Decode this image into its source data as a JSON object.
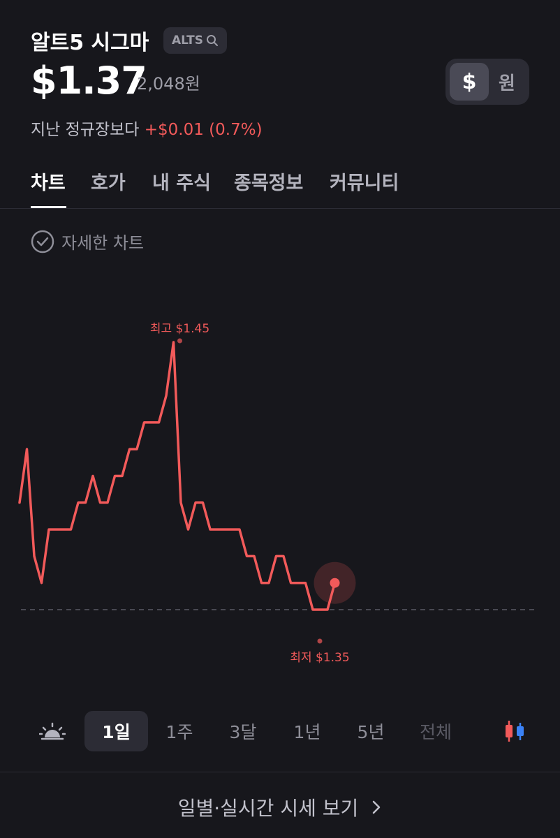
{
  "header": {
    "name": "알트5 시그마",
    "ticker": "ALTS",
    "price": "$1.37",
    "price_krw": "2,048원",
    "change_label": "지난 정규장보다",
    "change_value": "+$0.01 (0.7%)",
    "currency_usd": "$",
    "currency_krw": "원",
    "selected_currency": "$"
  },
  "tabs": [
    "차트",
    "호가",
    "내 주식",
    "종목정보",
    "커뮤니티"
  ],
  "active_tab": "차트",
  "detail_chart_label": "자세한 차트",
  "chart_data": {
    "type": "line",
    "color": "#f25a5a",
    "values": [
      1.39,
      1.41,
      1.37,
      1.36,
      1.38,
      1.38,
      1.38,
      1.38,
      1.39,
      1.39,
      1.4,
      1.39,
      1.39,
      1.4,
      1.4,
      1.41,
      1.41,
      1.42,
      1.42,
      1.42,
      1.43,
      1.45,
      1.39,
      1.38,
      1.39,
      1.39,
      1.38,
      1.38,
      1.38,
      1.38,
      1.38,
      1.37,
      1.37,
      1.36,
      1.36,
      1.37,
      1.37,
      1.36,
      1.36,
      1.36,
      1.35,
      1.35,
      1.35,
      1.36
    ],
    "high_label": "최고 $1.45",
    "low_label": "최저 $1.35",
    "baseline": 1.35
  },
  "ranges": [
    "1일",
    "1주",
    "3달",
    "1년",
    "5년",
    "전체"
  ],
  "active_range": "1일",
  "footer_link": "일별·실시간 시세 보기",
  "colors": {
    "up": "#f25a5a",
    "down": "#3b82f6",
    "background": "#17171c"
  }
}
